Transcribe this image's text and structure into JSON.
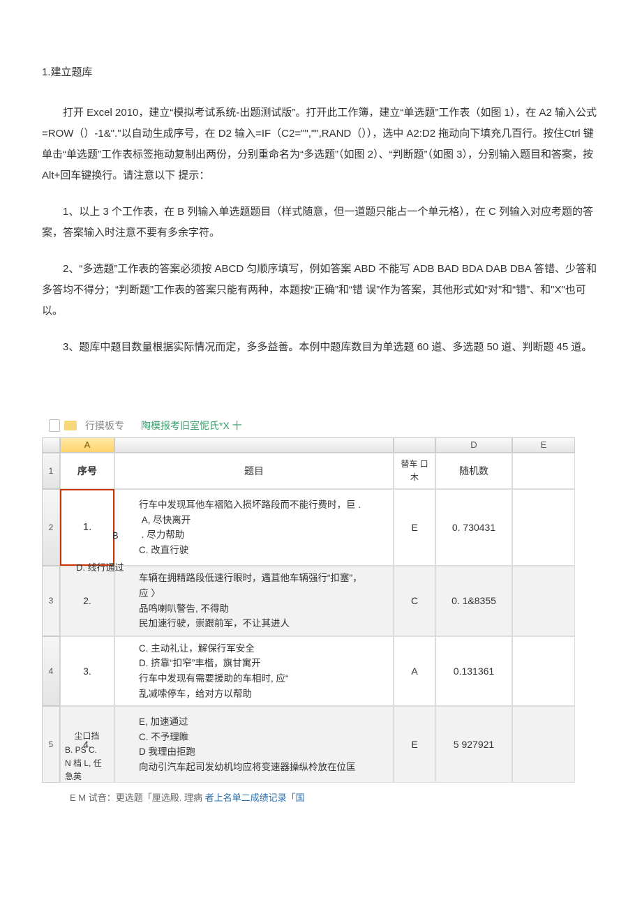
{
  "section1": {
    "title": "1.建立题库",
    "p1": "打开 Excel 2010，建立“模拟考试系统-出题测试版”。打开此工作簿，建立“单选题”工作表（如图 1），在 A2 输入公式=ROW（）-1&\".\"以自动生成序号，在 D2 输入=IF（C2=\"\",\"\",RAND（）），选中 A2:D2 拖动向下填充几百行。按住Ctrl 键单击“单选题”工作表标签拖动复制出两份，分别重命名为“多选题”（如图 2）、“判断题”（如图 3），分别输入题目和答案，按 Alt+回车键换行。请注意以下 提示：",
    "p2": "1、以上 3 个工作表，在 B 列输入单选题题目（样式随意，但一道题只能占一个单元格），在 C 列输入对应考题的答案，答案输入时注意不要有多余字符。",
    "p3": "2、“多选题”工作表的答案必须按 ABCD 匀顺序填写，例如答案 ABD 不能写 ADB BAD BDA DAB DBA 答错、少答和多答均不得分；“判断题”工作表的答案只能有两种，本题按“正确”和“错 误”作为答案，其他形式如“对”和“错”、和\"X\"也可以。",
    "p4": "3、题库中题目数量根据实际情况而定，多多益善。本例中题库数目为单选题 60 道、多选题 50 道、判断题 45 道。"
  },
  "tabs": {
    "template": "摸板专",
    "workbook": "陶模报考旧室怩氏*X 十"
  },
  "sheet": {
    "cols": [
      "",
      "A",
      "",
      "",
      "D",
      "E"
    ],
    "headers": {
      "seq": "序号",
      "question": "题目",
      "answer": "替车 口木",
      "rand": "随机数"
    },
    "rows": [
      {
        "n": "2",
        "seq": "1.",
        "b_extra": "B",
        "d_extra": "D. 线行通过",
        "q": "行车中发现耳他车褶陷入损坏路段而不能行费时，巨 .\n A, 尽快离开\n . 尽力帮助\nC. 改直行驶",
        "ans": "E",
        "rand": "0. 730431"
      },
      {
        "n": "3",
        "seq": "2.",
        "q": "车辆在拥精路段低速行眼时，遇苴他车辆强行“扣塞\"，\n应 〉\n品鸣喇叭警告, 不得助\n民加速行驶，崇跟前军，不让其进人",
        "ans": "C",
        "rand": "0. 1&8355"
      },
      {
        "n": "4",
        "seq": "3.",
        "q": "C. 主动礼让，解保行军安全\nD. 挤靠“扣窄”丰楷，旗甘寓开\n行车中发现有需要援助的车相时, 应“\n乱减嗦停车，给对方以帮助",
        "ans": "A",
        "rand": "0.131361"
      },
      {
        "n": "5",
        "seq": "4.",
        "b_extra": "    尘口挡\nB. PS C.\nN 档 L, 任\n急英",
        "q": "E, 加速通过\nC. 不予理睢\nD 我理由拒跑\n向动引汽车起司发幼机均应将变速器操纵柃放在位匡",
        "ans": "E",
        "rand": "5 927921"
      }
    ]
  },
  "footer": {
    "text_prefix": "E M 试音：更选题「厘选殿. 理病 ",
    "link": "者上名单二成绩记录「国"
  }
}
